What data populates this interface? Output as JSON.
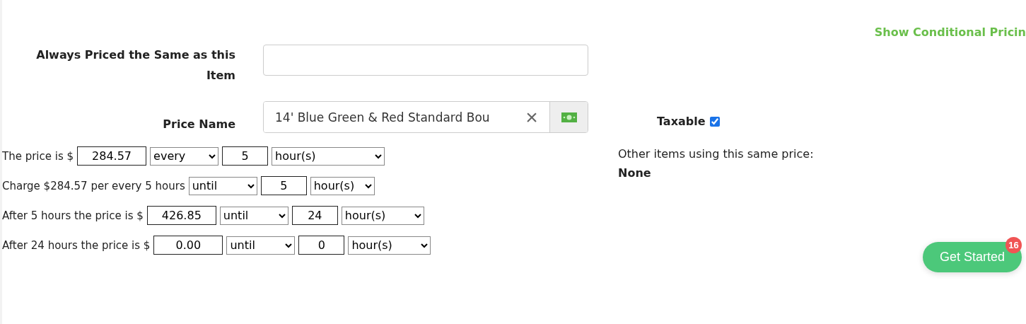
{
  "conditional_link": "Show Conditional Pricin",
  "always_priced_same": {
    "label": "Always Priced the Same as this Item"
  },
  "price_name": {
    "label": "Price Name",
    "value": "14' Blue Green & Red Standard Bou",
    "clear": "×"
  },
  "taxable": {
    "label": "Taxable",
    "checked": true
  },
  "pricing_rows": [
    {
      "text": "The price is $",
      "price": "284.57",
      "mode": "every",
      "amount": "5",
      "unit": "hour(s)"
    },
    {
      "text": "Charge $284.57 per every 5 hours",
      "mode": "until",
      "amount": "5",
      "unit": "hour(s)"
    },
    {
      "text": "After 5 hours the price is $",
      "price": "426.85",
      "mode": "until",
      "amount": "24",
      "unit": "hour(s)"
    },
    {
      "text": "After 24 hours the price is $",
      "price": "0.00",
      "mode": "until",
      "amount": "0",
      "unit": "hour(s)"
    }
  ],
  "other_items": {
    "label": "Other items using this same price:",
    "value": "None"
  },
  "get_started": {
    "label": "Get Started",
    "badge": "16"
  }
}
